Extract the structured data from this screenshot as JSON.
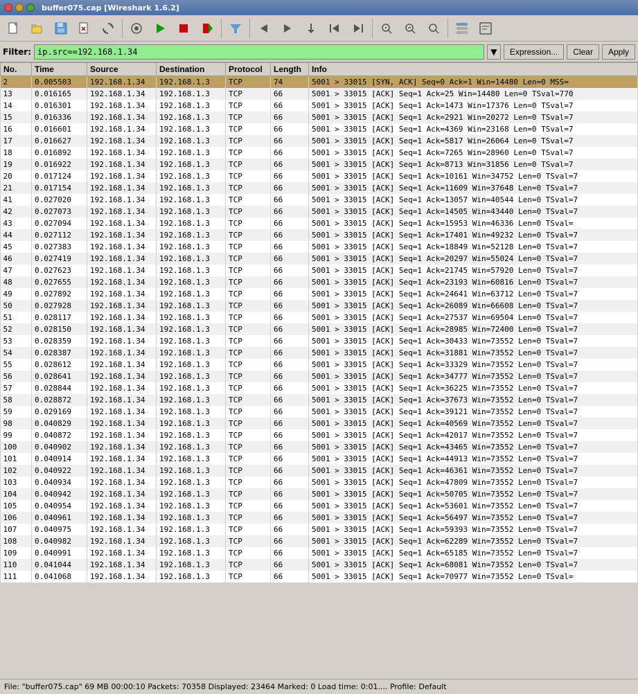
{
  "titlebar": {
    "title": "buffer075.cap [Wireshark 1.6.2]",
    "buttons": [
      {
        "name": "close",
        "color": "#ff5f57"
      },
      {
        "name": "minimize",
        "color": "#febc2e"
      },
      {
        "name": "maximize",
        "color": "#28c840"
      }
    ]
  },
  "toolbar": {
    "buttons": [
      {
        "name": "open-file",
        "icon": "📂"
      },
      {
        "name": "save",
        "icon": "💾"
      },
      {
        "name": "close-file",
        "icon": "✕"
      },
      {
        "name": "reload",
        "icon": "↺"
      },
      {
        "name": "capture-options",
        "icon": "⚙"
      },
      {
        "name": "start-capture",
        "icon": "▶"
      },
      {
        "name": "stop-capture",
        "icon": "⏹"
      },
      {
        "name": "restart-capture",
        "icon": "⟳"
      },
      {
        "name": "capture-filter",
        "icon": "🔍"
      },
      {
        "name": "step-backward",
        "icon": "⟵"
      },
      {
        "name": "step-forward",
        "icon": "⟶"
      },
      {
        "name": "go-back",
        "icon": "↩"
      },
      {
        "name": "go-first",
        "icon": "⤒"
      },
      {
        "name": "go-last",
        "icon": "⤓"
      },
      {
        "name": "zoom-in",
        "icon": "+🔍"
      },
      {
        "name": "zoom-out",
        "icon": "-🔍"
      },
      {
        "name": "zoom-normal",
        "icon": "🔍"
      }
    ]
  },
  "filterbar": {
    "label": "Filter:",
    "value": "ip.src==192.168.1.34",
    "placeholder": "ip.src==192.168.1.34",
    "expression_btn": "Expression...",
    "clear_btn": "Clear",
    "apply_btn": "Apply"
  },
  "columns": [
    {
      "key": "no",
      "label": "No."
    },
    {
      "key": "time",
      "label": "Time"
    },
    {
      "key": "source",
      "label": "Source"
    },
    {
      "key": "destination",
      "label": "Destination"
    },
    {
      "key": "protocol",
      "label": "Protocol"
    },
    {
      "key": "length",
      "label": "Length"
    },
    {
      "key": "info",
      "label": "Info"
    }
  ],
  "packets": [
    {
      "no": "2",
      "time": "0.005503",
      "source": "192.168.1.34",
      "destination": "192.168.1.3",
      "protocol": "TCP",
      "length": "74",
      "info": "5001 > 33015 [SYN, ACK] Seq=0 Ack=1 Win=14480 Len=0 MSS=",
      "selected": true
    },
    {
      "no": "13",
      "time": "0.016165",
      "source": "192.168.1.34",
      "destination": "192.168.1.3",
      "protocol": "TCP",
      "length": "66",
      "info": "5001 > 33015 [ACK] Seq=1 Ack=25 Win=14480 Len=0 TSval=770"
    },
    {
      "no": "14",
      "time": "0.016301",
      "source": "192.168.1.34",
      "destination": "192.168.1.3",
      "protocol": "TCP",
      "length": "66",
      "info": "5001 > 33015 [ACK] Seq=1 Ack=1473 Win=17376 Len=0 TSval=7"
    },
    {
      "no": "15",
      "time": "0.016336",
      "source": "192.168.1.34",
      "destination": "192.168.1.3",
      "protocol": "TCP",
      "length": "66",
      "info": "5001 > 33015 [ACK] Seq=1 Ack=2921 Win=20272 Len=0 TSval=7"
    },
    {
      "no": "16",
      "time": "0.016601",
      "source": "192.168.1.34",
      "destination": "192.168.1.3",
      "protocol": "TCP",
      "length": "66",
      "info": "5001 > 33015 [ACK] Seq=1 Ack=4369 Win=23168 Len=0 TSval=7"
    },
    {
      "no": "17",
      "time": "0.016627",
      "source": "192.168.1.34",
      "destination": "192.168.1.3",
      "protocol": "TCP",
      "length": "66",
      "info": "5001 > 33015 [ACK] Seq=1 Ack=5817 Win=26064 Len=0 TSval=7"
    },
    {
      "no": "18",
      "time": "0.016892",
      "source": "192.168.1.34",
      "destination": "192.168.1.3",
      "protocol": "TCP",
      "length": "66",
      "info": "5001 > 33015 [ACK] Seq=1 Ack=7265 Win=28960 Len=0 TSval=7"
    },
    {
      "no": "19",
      "time": "0.016922",
      "source": "192.168.1.34",
      "destination": "192.168.1.3",
      "protocol": "TCP",
      "length": "66",
      "info": "5001 > 33015 [ACK] Seq=1 Ack=8713 Win=31856 Len=0 TSval=7"
    },
    {
      "no": "20",
      "time": "0.017124",
      "source": "192.168.1.34",
      "destination": "192.168.1.3",
      "protocol": "TCP",
      "length": "66",
      "info": "5001 > 33015 [ACK] Seq=1 Ack=10161 Win=34752 Len=0 TSval=7"
    },
    {
      "no": "21",
      "time": "0.017154",
      "source": "192.168.1.34",
      "destination": "192.168.1.3",
      "protocol": "TCP",
      "length": "66",
      "info": "5001 > 33015 [ACK] Seq=1 Ack=11609 Win=37648 Len=0 TSval=7"
    },
    {
      "no": "41",
      "time": "0.027020",
      "source": "192.168.1.34",
      "destination": "192.168.1.3",
      "protocol": "TCP",
      "length": "66",
      "info": "5001 > 33015 [ACK] Seq=1 Ack=13057 Win=40544 Len=0 TSval=7"
    },
    {
      "no": "42",
      "time": "0.027073",
      "source": "192.168.1.34",
      "destination": "192.168.1.3",
      "protocol": "TCP",
      "length": "66",
      "info": "5001 > 33015 [ACK] Seq=1 Ack=14505 Win=43440 Len=0 TSval=7"
    },
    {
      "no": "43",
      "time": "0.027094",
      "source": "192.168.1.34",
      "destination": "192.168.1.3",
      "protocol": "TCP",
      "length": "66",
      "info": "5001 > 33015 [ACK] Seq=1 Ack=15953 Win=46336 Len=0 TSval="
    },
    {
      "no": "44",
      "time": "0.027112",
      "source": "192.168.1.34",
      "destination": "192.168.1.3",
      "protocol": "TCP",
      "length": "66",
      "info": "5001 > 33015 [ACK] Seq=1 Ack=17401 Win=49232 Len=0 TSval=7"
    },
    {
      "no": "45",
      "time": "0.027383",
      "source": "192.168.1.34",
      "destination": "192.168.1.3",
      "protocol": "TCP",
      "length": "66",
      "info": "5001 > 33015 [ACK] Seq=1 Ack=18849 Win=52128 Len=0 TSval=7"
    },
    {
      "no": "46",
      "time": "0.027419",
      "source": "192.168.1.34",
      "destination": "192.168.1.3",
      "protocol": "TCP",
      "length": "66",
      "info": "5001 > 33015 [ACK] Seq=1 Ack=20297 Win=55024 Len=0 TSval=7"
    },
    {
      "no": "47",
      "time": "0.027623",
      "source": "192.168.1.34",
      "destination": "192.168.1.3",
      "protocol": "TCP",
      "length": "66",
      "info": "5001 > 33015 [ACK] Seq=1 Ack=21745 Win=57920 Len=0 TSval=7"
    },
    {
      "no": "48",
      "time": "0.027655",
      "source": "192.168.1.34",
      "destination": "192.168.1.3",
      "protocol": "TCP",
      "length": "66",
      "info": "5001 > 33015 [ACK] Seq=1 Ack=23193 Win=60816 Len=0 TSval=7"
    },
    {
      "no": "49",
      "time": "0.027892",
      "source": "192.168.1.34",
      "destination": "192.168.1.3",
      "protocol": "TCP",
      "length": "66",
      "info": "5001 > 33015 [ACK] Seq=1 Ack=24641 Win=63712 Len=0 TSval=7"
    },
    {
      "no": "50",
      "time": "0.027928",
      "source": "192.168.1.34",
      "destination": "192.168.1.3",
      "protocol": "TCP",
      "length": "66",
      "info": "5001 > 33015 [ACK] Seq=1 Ack=26089 Win=66608 Len=0 TSval=7"
    },
    {
      "no": "51",
      "time": "0.028117",
      "source": "192.168.1.34",
      "destination": "192.168.1.3",
      "protocol": "TCP",
      "length": "66",
      "info": "5001 > 33015 [ACK] Seq=1 Ack=27537 Win=69504 Len=0 TSval=7"
    },
    {
      "no": "52",
      "time": "0.028150",
      "source": "192.168.1.34",
      "destination": "192.168.1.3",
      "protocol": "TCP",
      "length": "66",
      "info": "5001 > 33015 [ACK] Seq=1 Ack=28985 Win=72400 Len=0 TSval=7"
    },
    {
      "no": "53",
      "time": "0.028359",
      "source": "192.168.1.34",
      "destination": "192.168.1.3",
      "protocol": "TCP",
      "length": "66",
      "info": "5001 > 33015 [ACK] Seq=1 Ack=30433 Win=73552 Len=0 TSval=7"
    },
    {
      "no": "54",
      "time": "0.028387",
      "source": "192.168.1.34",
      "destination": "192.168.1.3",
      "protocol": "TCP",
      "length": "66",
      "info": "5001 > 33015 [ACK] Seq=1 Ack=31881 Win=73552 Len=0 TSval=7"
    },
    {
      "no": "55",
      "time": "0.028612",
      "source": "192.168.1.34",
      "destination": "192.168.1.3",
      "protocol": "TCP",
      "length": "66",
      "info": "5001 > 33015 [ACK] Seq=1 Ack=33329 Win=73552 Len=0 TSval=7"
    },
    {
      "no": "56",
      "time": "0.028641",
      "source": "192.168.1.34",
      "destination": "192.168.1.3",
      "protocol": "TCP",
      "length": "66",
      "info": "5001 > 33015 [ACK] Seq=1 Ack=34777 Win=73552 Len=0 TSval=7"
    },
    {
      "no": "57",
      "time": "0.028844",
      "source": "192.168.1.34",
      "destination": "192.168.1.3",
      "protocol": "TCP",
      "length": "66",
      "info": "5001 > 33015 [ACK] Seq=1 Ack=36225 Win=73552 Len=0 TSval=7"
    },
    {
      "no": "58",
      "time": "0.028872",
      "source": "192.168.1.34",
      "destination": "192.168.1.3",
      "protocol": "TCP",
      "length": "66",
      "info": "5001 > 33015 [ACK] Seq=1 Ack=37673 Win=73552 Len=0 TSval=7"
    },
    {
      "no": "59",
      "time": "0.029169",
      "source": "192.168.1.34",
      "destination": "192.168.1.3",
      "protocol": "TCP",
      "length": "66",
      "info": "5001 > 33015 [ACK] Seq=1 Ack=39121 Win=73552 Len=0 TSval=7"
    },
    {
      "no": "98",
      "time": "0.040829",
      "source": "192.168.1.34",
      "destination": "192.168.1.3",
      "protocol": "TCP",
      "length": "66",
      "info": "5001 > 33015 [ACK] Seq=1 Ack=40569 Win=73552 Len=0 TSval=7"
    },
    {
      "no": "99",
      "time": "0.040872",
      "source": "192.168.1.34",
      "destination": "192.168.1.3",
      "protocol": "TCP",
      "length": "66",
      "info": "5001 > 33015 [ACK] Seq=1 Ack=42017 Win=73552 Len=0 TSval=7"
    },
    {
      "no": "100",
      "time": "0.040902",
      "source": "192.168.1.34",
      "destination": "192.168.1.3",
      "protocol": "TCP",
      "length": "66",
      "info": "5001 > 33015 [ACK] Seq=1 Ack=43465 Win=73552 Len=0 TSval=7"
    },
    {
      "no": "101",
      "time": "0.040914",
      "source": "192.168.1.34",
      "destination": "192.168.1.3",
      "protocol": "TCP",
      "length": "66",
      "info": "5001 > 33015 [ACK] Seq=1 Ack=44913 Win=73552 Len=0 TSval=7"
    },
    {
      "no": "102",
      "time": "0.040922",
      "source": "192.168.1.34",
      "destination": "192.168.1.3",
      "protocol": "TCP",
      "length": "66",
      "info": "5001 > 33015 [ACK] Seq=1 Ack=46361 Win=73552 Len=0 TSval=7"
    },
    {
      "no": "103",
      "time": "0.040934",
      "source": "192.168.1.34",
      "destination": "192.168.1.3",
      "protocol": "TCP",
      "length": "66",
      "info": "5001 > 33015 [ACK] Seq=1 Ack=47809 Win=73552 Len=0 TSval=7"
    },
    {
      "no": "104",
      "time": "0.040942",
      "source": "192.168.1.34",
      "destination": "192.168.1.3",
      "protocol": "TCP",
      "length": "66",
      "info": "5001 > 33015 [ACK] Seq=1 Ack=50705 Win=73552 Len=0 TSval=7"
    },
    {
      "no": "105",
      "time": "0.040954",
      "source": "192.168.1.34",
      "destination": "192.168.1.3",
      "protocol": "TCP",
      "length": "66",
      "info": "5001 > 33015 [ACK] Seq=1 Ack=53601 Win=73552 Len=0 TSval=7"
    },
    {
      "no": "106",
      "time": "0.040961",
      "source": "192.168.1.34",
      "destination": "192.168.1.3",
      "protocol": "TCP",
      "length": "66",
      "info": "5001 > 33015 [ACK] Seq=1 Ack=56497 Win=73552 Len=0 TSval=7"
    },
    {
      "no": "107",
      "time": "0.040975",
      "source": "192.168.1.34",
      "destination": "192.168.1.3",
      "protocol": "TCP",
      "length": "66",
      "info": "5001 > 33015 [ACK] Seq=1 Ack=59393 Win=73552 Len=0 TSval=7"
    },
    {
      "no": "108",
      "time": "0.040982",
      "source": "192.168.1.34",
      "destination": "192.168.1.3",
      "protocol": "TCP",
      "length": "66",
      "info": "5001 > 33015 [ACK] Seq=1 Ack=62289 Win=73552 Len=0 TSval=7"
    },
    {
      "no": "109",
      "time": "0.040991",
      "source": "192.168.1.34",
      "destination": "192.168.1.3",
      "protocol": "TCP",
      "length": "66",
      "info": "5001 > 33015 [ACK] Seq=1 Ack=65185 Win=73552 Len=0 TSval=7"
    },
    {
      "no": "110",
      "time": "0.041044",
      "source": "192.168.1.34",
      "destination": "192.168.1.3",
      "protocol": "TCP",
      "length": "66",
      "info": "5001 > 33015 [ACK] Seq=1 Ack=68081 Win=73552 Len=0 TSval=7"
    },
    {
      "no": "111",
      "time": "0.041068",
      "source": "192.168.1.34",
      "destination": "192.168.1.3",
      "protocol": "TCP",
      "length": "66",
      "info": "5001 > 33015 [ACK] Seq=1 Ack=70977 Win=73552 Len=0 TSval="
    }
  ],
  "statusbar": {
    "text": "File: \"buffer075.cap\" 69 MB 00:00:10   Packets: 70358 Displayed: 23464 Marked: 0 Load time: 0:01....   Profile: Default"
  }
}
